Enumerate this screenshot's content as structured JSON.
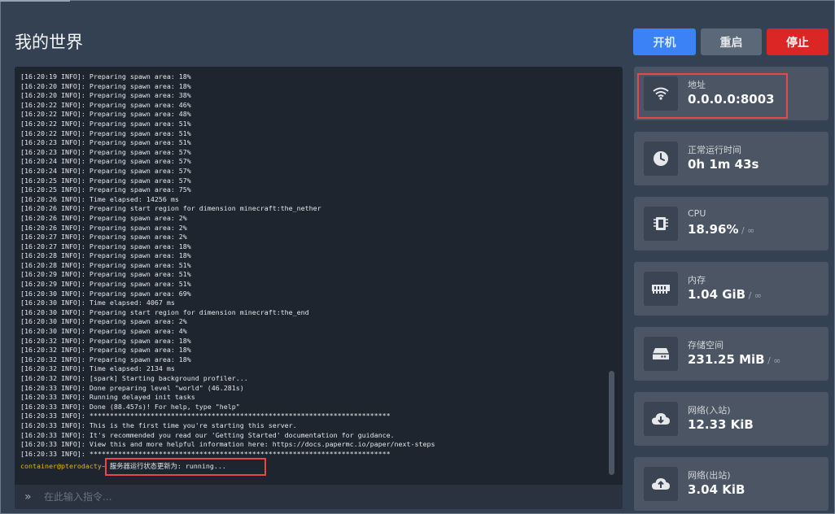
{
  "page": {
    "title": "我的世界"
  },
  "controls": {
    "start_label": "开机",
    "restart_label": "重启",
    "stop_label": "停止"
  },
  "console": {
    "lines": [
      "[16:20:19 INFO]: Preparing spawn area: 18%",
      "[16:20:20 INFO]: Preparing spawn area: 18%",
      "[16:20:20 INFO]: Preparing spawn area: 38%",
      "[16:20:22 INFO]: Preparing spawn area: 46%",
      "[16:20:22 INFO]: Preparing spawn area: 48%",
      "[16:20:22 INFO]: Preparing spawn area: 51%",
      "[16:20:22 INFO]: Preparing spawn area: 51%",
      "[16:20:23 INFO]: Preparing spawn area: 51%",
      "[16:20:23 INFO]: Preparing spawn area: 57%",
      "[16:20:24 INFO]: Preparing spawn area: 57%",
      "[16:20:24 INFO]: Preparing spawn area: 57%",
      "[16:20:25 INFO]: Preparing spawn area: 57%",
      "[16:20:25 INFO]: Preparing spawn area: 75%",
      "[16:20:26 INFO]: Time elapsed: 14256 ms",
      "[16:20:26 INFO]: Preparing start region for dimension minecraft:the_nether",
      "[16:20:26 INFO]: Preparing spawn area: 2%",
      "[16:20:26 INFO]: Preparing spawn area: 2%",
      "[16:20:27 INFO]: Preparing spawn area: 2%",
      "[16:20:27 INFO]: Preparing spawn area: 18%",
      "[16:20:28 INFO]: Preparing spawn area: 18%",
      "[16:20:28 INFO]: Preparing spawn area: 51%",
      "[16:20:29 INFO]: Preparing spawn area: 51%",
      "[16:20:29 INFO]: Preparing spawn area: 51%",
      "[16:20:30 INFO]: Preparing spawn area: 69%",
      "[16:20:30 INFO]: Time elapsed: 4067 ms",
      "[16:20:30 INFO]: Preparing start region for dimension minecraft:the_end",
      "[16:20:30 INFO]: Preparing spawn area: 2%",
      "[16:20:30 INFO]: Preparing spawn area: 4%",
      "[16:20:32 INFO]: Preparing spawn area: 18%",
      "[16:20:32 INFO]: Preparing spawn area: 18%",
      "[16:20:32 INFO]: Preparing spawn area: 18%",
      "[16:20:32 INFO]: Time elapsed: 2134 ms",
      "[16:20:32 INFO]: [spark] Starting background profiler...",
      "[16:20:33 INFO]: Done preparing level \"world\" (46.281s)",
      "[16:20:33 INFO]: Running delayed init tasks",
      "[16:20:33 INFO]: Done (88.457s)! For help, type \"help\"",
      "[16:20:33 INFO]: **************************************************************************",
      "[16:20:33 INFO]: This is the first time you're starting this server.",
      "[16:20:33 INFO]: It's recommended you read our 'Getting Started' documentation for guidance.",
      "[16:20:33 INFO]: View this and more helpful information here: https://docs.papermc.io/paper/next-steps",
      "[16:20:33 INFO]: **************************************************************************"
    ],
    "prompt_user": "container@pterodacty~",
    "status_message": " 服务器运行状态更新为: running...",
    "input_placeholder": "在此输入指令..."
  },
  "stats": {
    "address": {
      "label": "地址",
      "value": "0.0.0.0:8003",
      "icon": "wifi-icon"
    },
    "uptime": {
      "label": "正常运行时间",
      "value": "0h 1m 43s",
      "icon": "clock-icon"
    },
    "cpu": {
      "label": "CPU",
      "value": "18.96%",
      "limit": " / ∞",
      "icon": "cpu-icon"
    },
    "memory": {
      "label": "内存",
      "value": "1.04 GiB",
      "limit": " / ∞",
      "icon": "memory-icon"
    },
    "disk": {
      "label": "存储空间",
      "value": "231.25 MiB",
      "limit": " / ∞",
      "icon": "hard-drive-icon"
    },
    "net_in": {
      "label": "网络(入站)",
      "value": "12.33 KiB",
      "icon": "cloud-download-icon"
    },
    "net_out": {
      "label": "网络(出站)",
      "value": "3.04 KiB",
      "icon": "cloud-upload-icon"
    }
  },
  "colors": {
    "accent": "#3b82f6",
    "danger": "#dc2626",
    "highlight": "#e5484d"
  }
}
